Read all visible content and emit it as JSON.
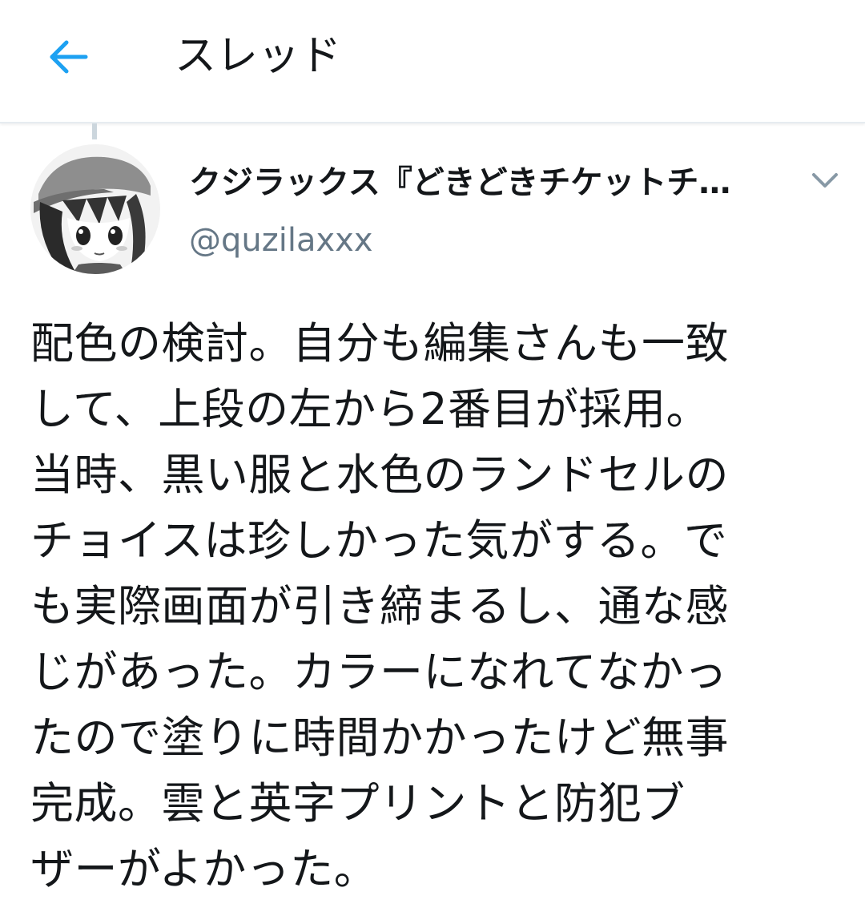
{
  "header": {
    "title": "スレッド",
    "back_icon": "arrow-left-icon",
    "accent_color": "#1da1f2"
  },
  "tweet": {
    "author": {
      "display_name": "クジラックス『どきどきチケットチ…",
      "handle": "@quzilaxxx",
      "avatar_icon": "user-avatar"
    },
    "menu_icon": "chevron-down-icon",
    "text": "配色の検討。自分も編集さんも一致\nして、上段の左から2番目が採用。\n当時、黒い服と水色のランドセルの\nチョイスは珍しかった気がする。で\nも実際画面が引き締まるし、通な感\nじがあった。カラーになれてなかっ\nたので塗りに時間かかったけど無事\n完成。雲と英字プリントと防犯ブ\nザーがよかった。"
  }
}
